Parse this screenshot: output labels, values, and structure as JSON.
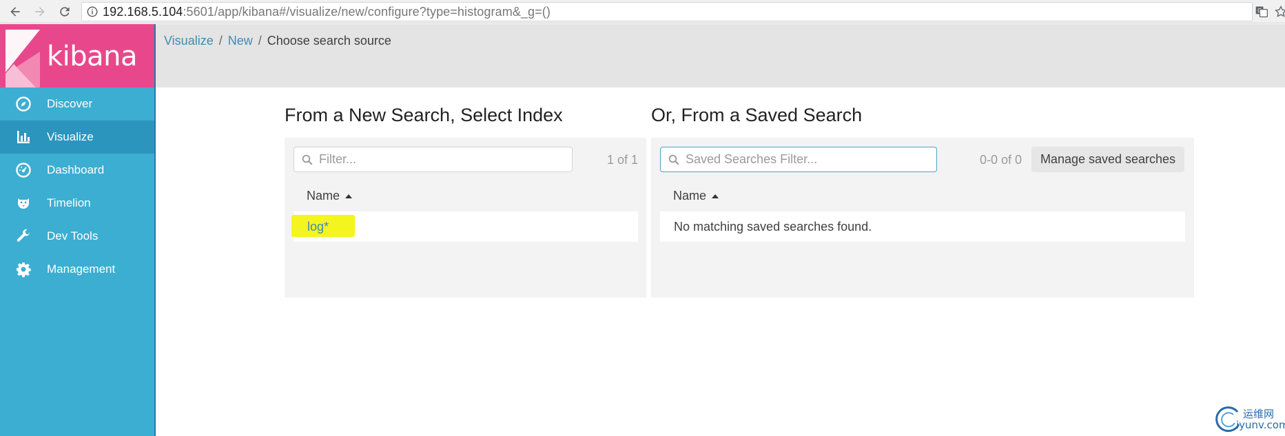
{
  "browser": {
    "url_host": "192.168.5.104",
    "url_rest": ":5601/app/kibana#/visualize/new/configure?type=histogram&_g=()"
  },
  "app": {
    "logo_text": "kibana",
    "brand_color": "#e8488b",
    "sidebar_color": "#3caed2"
  },
  "sidebar": {
    "items": [
      {
        "label": "Discover",
        "icon": "compass-icon",
        "active": false
      },
      {
        "label": "Visualize",
        "icon": "bar-chart-icon",
        "active": true
      },
      {
        "label": "Dashboard",
        "icon": "dashboard-icon",
        "active": false
      },
      {
        "label": "Timelion",
        "icon": "timelion-icon",
        "active": false
      },
      {
        "label": "Dev Tools",
        "icon": "wrench-icon",
        "active": false
      },
      {
        "label": "Management",
        "icon": "gear-icon",
        "active": false
      }
    ]
  },
  "breadcrumb": {
    "items": [
      "Visualize",
      "New"
    ],
    "separator": "/",
    "current": "Choose search source"
  },
  "index_panel": {
    "title": "From a New Search, Select Index",
    "filter_placeholder": "Filter...",
    "pager": "1 of 1",
    "column": "Name",
    "rows": [
      "log*"
    ]
  },
  "saved_panel": {
    "title": "Or, From a Saved Search",
    "filter_placeholder": "Saved Searches Filter...",
    "pager": "0-0 of 0",
    "manage_label": "Manage saved searches",
    "column": "Name",
    "empty_message": "No matching saved searches found."
  },
  "watermark": {
    "cn": "运维网",
    "en": "iyunv.com"
  }
}
